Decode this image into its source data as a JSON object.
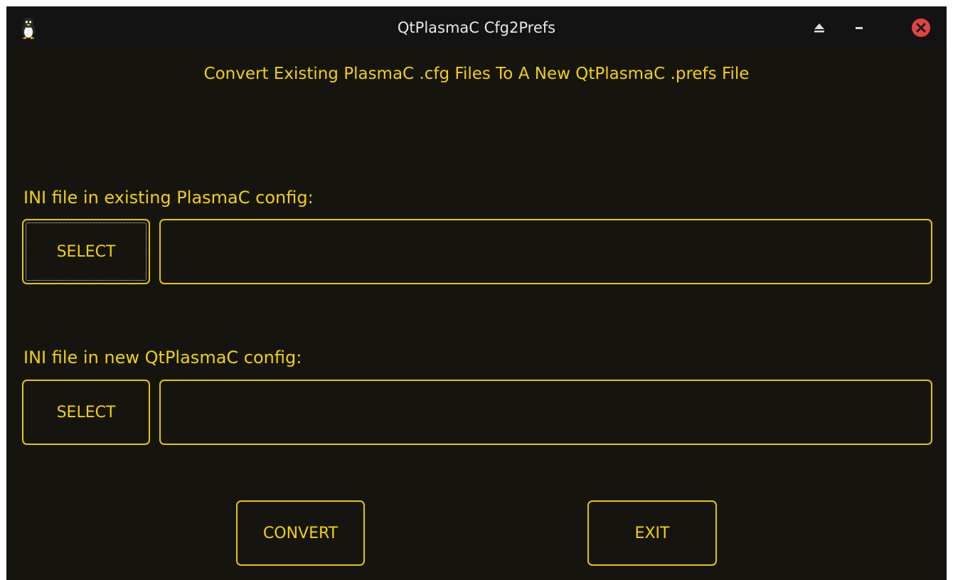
{
  "window": {
    "title": "QtPlasmaC Cfg2Prefs",
    "icons": {
      "app": "tux-icon",
      "eject": "eject-icon",
      "minimize": "minimize-icon",
      "close": "close-icon"
    }
  },
  "main": {
    "heading": "Convert Existing PlasmaC .cfg Files To A New QtPlasmaC .prefs File",
    "existing": {
      "label": "INI file in existing PlasmaC config:",
      "select_label": "SELECT",
      "value": ""
    },
    "new": {
      "label": "INI file in new QtPlasmaC config:",
      "select_label": "SELECT",
      "value": ""
    },
    "convert_label": "CONVERT",
    "exit_label": "EXIT"
  },
  "colors": {
    "background": "#16140f",
    "titlebar": "#131313",
    "accent": "#f0d20a",
    "close": "#e04343"
  }
}
